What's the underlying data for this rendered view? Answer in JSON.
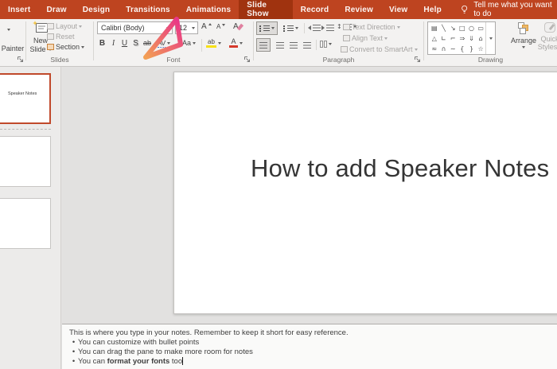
{
  "tabbar": {
    "tabs": [
      "Insert",
      "Draw",
      "Design",
      "Transitions",
      "Animations",
      "Slide Show",
      "Record",
      "Review",
      "View",
      "Help"
    ],
    "active_tab": "Slide Show",
    "tell_me_label": "Tell me what you want to do"
  },
  "ribbon": {
    "clipboard": {
      "painter_label": "Painter"
    },
    "slides": {
      "new_slide_l1": "New",
      "new_slide_l2": "Slide",
      "layout_label": "Layout",
      "reset_label": "Reset",
      "section_label": "Section",
      "group_label": "Slides"
    },
    "font": {
      "family_value": "Calibri (Body)",
      "size_value": "12",
      "bold_label": "B",
      "italic_label": "I",
      "underline_label": "U",
      "shadow_label": "S",
      "strikethrough_glyph": "ab",
      "spacing_glyph": "AV",
      "case_glyph": "Aa",
      "highlight_glyph": "ab",
      "color_glyph": "A",
      "grow_glyph": "A",
      "shrink_glyph": "A",
      "clear_glyph": "A",
      "group_label": "Font"
    },
    "paragraph": {
      "text_direction_label": "Text Direction",
      "align_text_label": "Align Text",
      "smartart_label": "Convert to SmartArt",
      "group_label": "Paragraph"
    },
    "drawing": {
      "shapes_glyphs": [
        "▤",
        "╲",
        "↘",
        "□",
        "○",
        "▭",
        "△",
        "∟",
        "⌐",
        "⇒",
        "⇓",
        "⌂",
        "≈",
        "∩",
        "∼",
        "{",
        "}",
        "☆"
      ],
      "arrange_label": "Arrange",
      "quick_l1": "Quick",
      "quick_l2": "Styles",
      "group_label": "Drawing"
    }
  },
  "thumbnail_panel": {
    "slide1_text": "Speaker Notes"
  },
  "slide": {
    "title": "How to add Speaker Notes"
  },
  "notes_pane": {
    "intro": "This is where you type in your notes. Remember to keep it short for easy reference.",
    "bullet_char": "•",
    "bullet1": "You can customize with bullet points",
    "bullet2": "You can drag the pane to make more room for notes",
    "bullet3_pre": "You can ",
    "bullet3_bold": "format your fonts",
    "bullet3_post": " too"
  },
  "colors": {
    "ribbon_red": "#BE4420",
    "active_tab_red": "#A0330F",
    "selected_thumb_border": "#C0492B",
    "highlight_yellow": "#F7E017",
    "font_color_red": "#D5392B"
  }
}
